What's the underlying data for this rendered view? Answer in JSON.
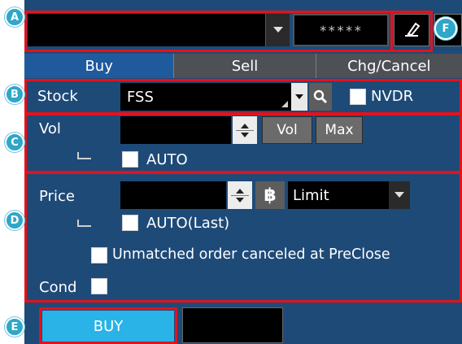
{
  "header": {
    "account_value": "",
    "password_mask": "*****"
  },
  "markers": {
    "a": "A",
    "b": "B",
    "c": "C",
    "d": "D",
    "e": "E",
    "f": "F"
  },
  "tabs": [
    {
      "label": "Buy",
      "active": true
    },
    {
      "label": "Sell",
      "active": false
    },
    {
      "label": "Chg/Cancel",
      "active": false
    }
  ],
  "stock": {
    "label": "Stock",
    "value": "FSS",
    "nvdr_label": "NVDR",
    "nvdr_checked": false
  },
  "volume": {
    "label": "Vol",
    "value": "",
    "vol_button": "Vol",
    "max_button": "Max",
    "auto_label": "AUTO",
    "auto_checked": false
  },
  "price": {
    "label": "Price",
    "value": "",
    "currency_symbol": "฿",
    "type_value": "Limit",
    "auto_last_label": "AUTO(Last)",
    "auto_last_checked": false,
    "unmatched_label": "Unmatched order canceled at PreClose",
    "unmatched_checked": false,
    "cond_label": "Cond",
    "cond_checked": false
  },
  "actions": {
    "buy_label": "BUY",
    "extra_field_value": ""
  },
  "colors": {
    "panel_bg": "#1e4a78",
    "highlight": "#e3121b",
    "buy_button": "#29b3e6",
    "marker": "#2ea7c9"
  }
}
